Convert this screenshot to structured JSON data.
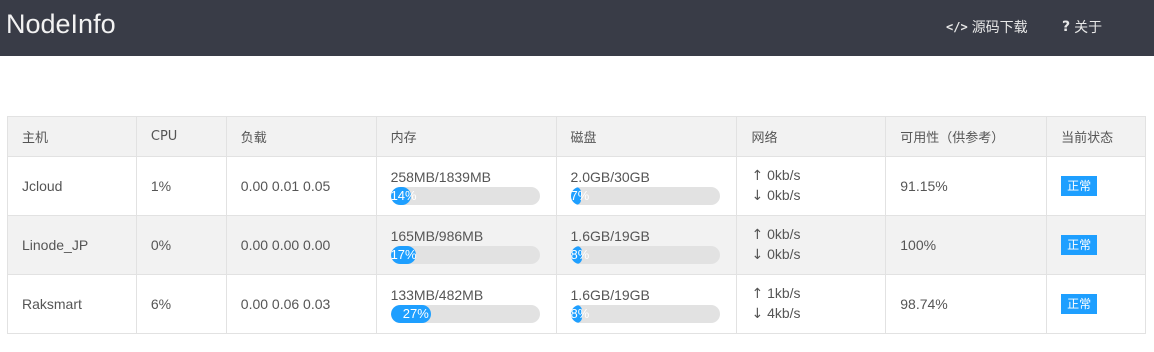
{
  "navbar": {
    "brand": "NodeInfo",
    "source_icon": "</>",
    "source_label": "源码下载",
    "about_icon": "?",
    "about_label": "关于",
    "icons": {
      "source": "code-icon",
      "about": "question-icon"
    },
    "background_color": "#393c47"
  },
  "table": {
    "headers": [
      "主机",
      "CPU",
      "负载",
      "内存",
      "磁盘",
      "网络",
      "可用性（供参考）",
      "当前状态"
    ],
    "rows": [
      {
        "host": "Jcloud",
        "cpu": "1%",
        "load": "0.00 0.01 0.05",
        "memory": {
          "text": "258MB/1839MB",
          "percent_label": "14%",
          "percent": 14
        },
        "disk": {
          "text": "2.0GB/30GB",
          "percent_label": "7%",
          "percent": 7
        },
        "network": {
          "up_arrow": "↑",
          "up": "0kb/s",
          "down_arrow": "↓",
          "down": "0kb/s"
        },
        "availability": "91.15%",
        "status": "正常"
      },
      {
        "host": "Linode_JP",
        "cpu": "0%",
        "load": "0.00 0.00 0.00",
        "memory": {
          "text": "165MB/986MB",
          "percent_label": "17%",
          "percent": 17
        },
        "disk": {
          "text": "1.6GB/19GB",
          "percent_label": "8%",
          "percent": 8
        },
        "network": {
          "up_arrow": "↑",
          "up": "0kb/s",
          "down_arrow": "↓",
          "down": "0kb/s"
        },
        "availability": "100%",
        "status": "正常"
      },
      {
        "host": "Raksmart",
        "cpu": "6%",
        "load": "0.00 0.06 0.03",
        "memory": {
          "text": "133MB/482MB",
          "percent_label": "27%",
          "percent": 27
        },
        "disk": {
          "text": "1.6GB/19GB",
          "percent_label": "8%",
          "percent": 8
        },
        "network": {
          "up_arrow": "↑",
          "up": "1kb/s",
          "down_arrow": "↓",
          "down": "4kb/s"
        },
        "availability": "98.74%",
        "status": "正常"
      }
    ]
  },
  "colors": {
    "accent": "#1e9fff",
    "bar_track": "#e2e2e2",
    "header_bg": "#f2f2f2"
  }
}
